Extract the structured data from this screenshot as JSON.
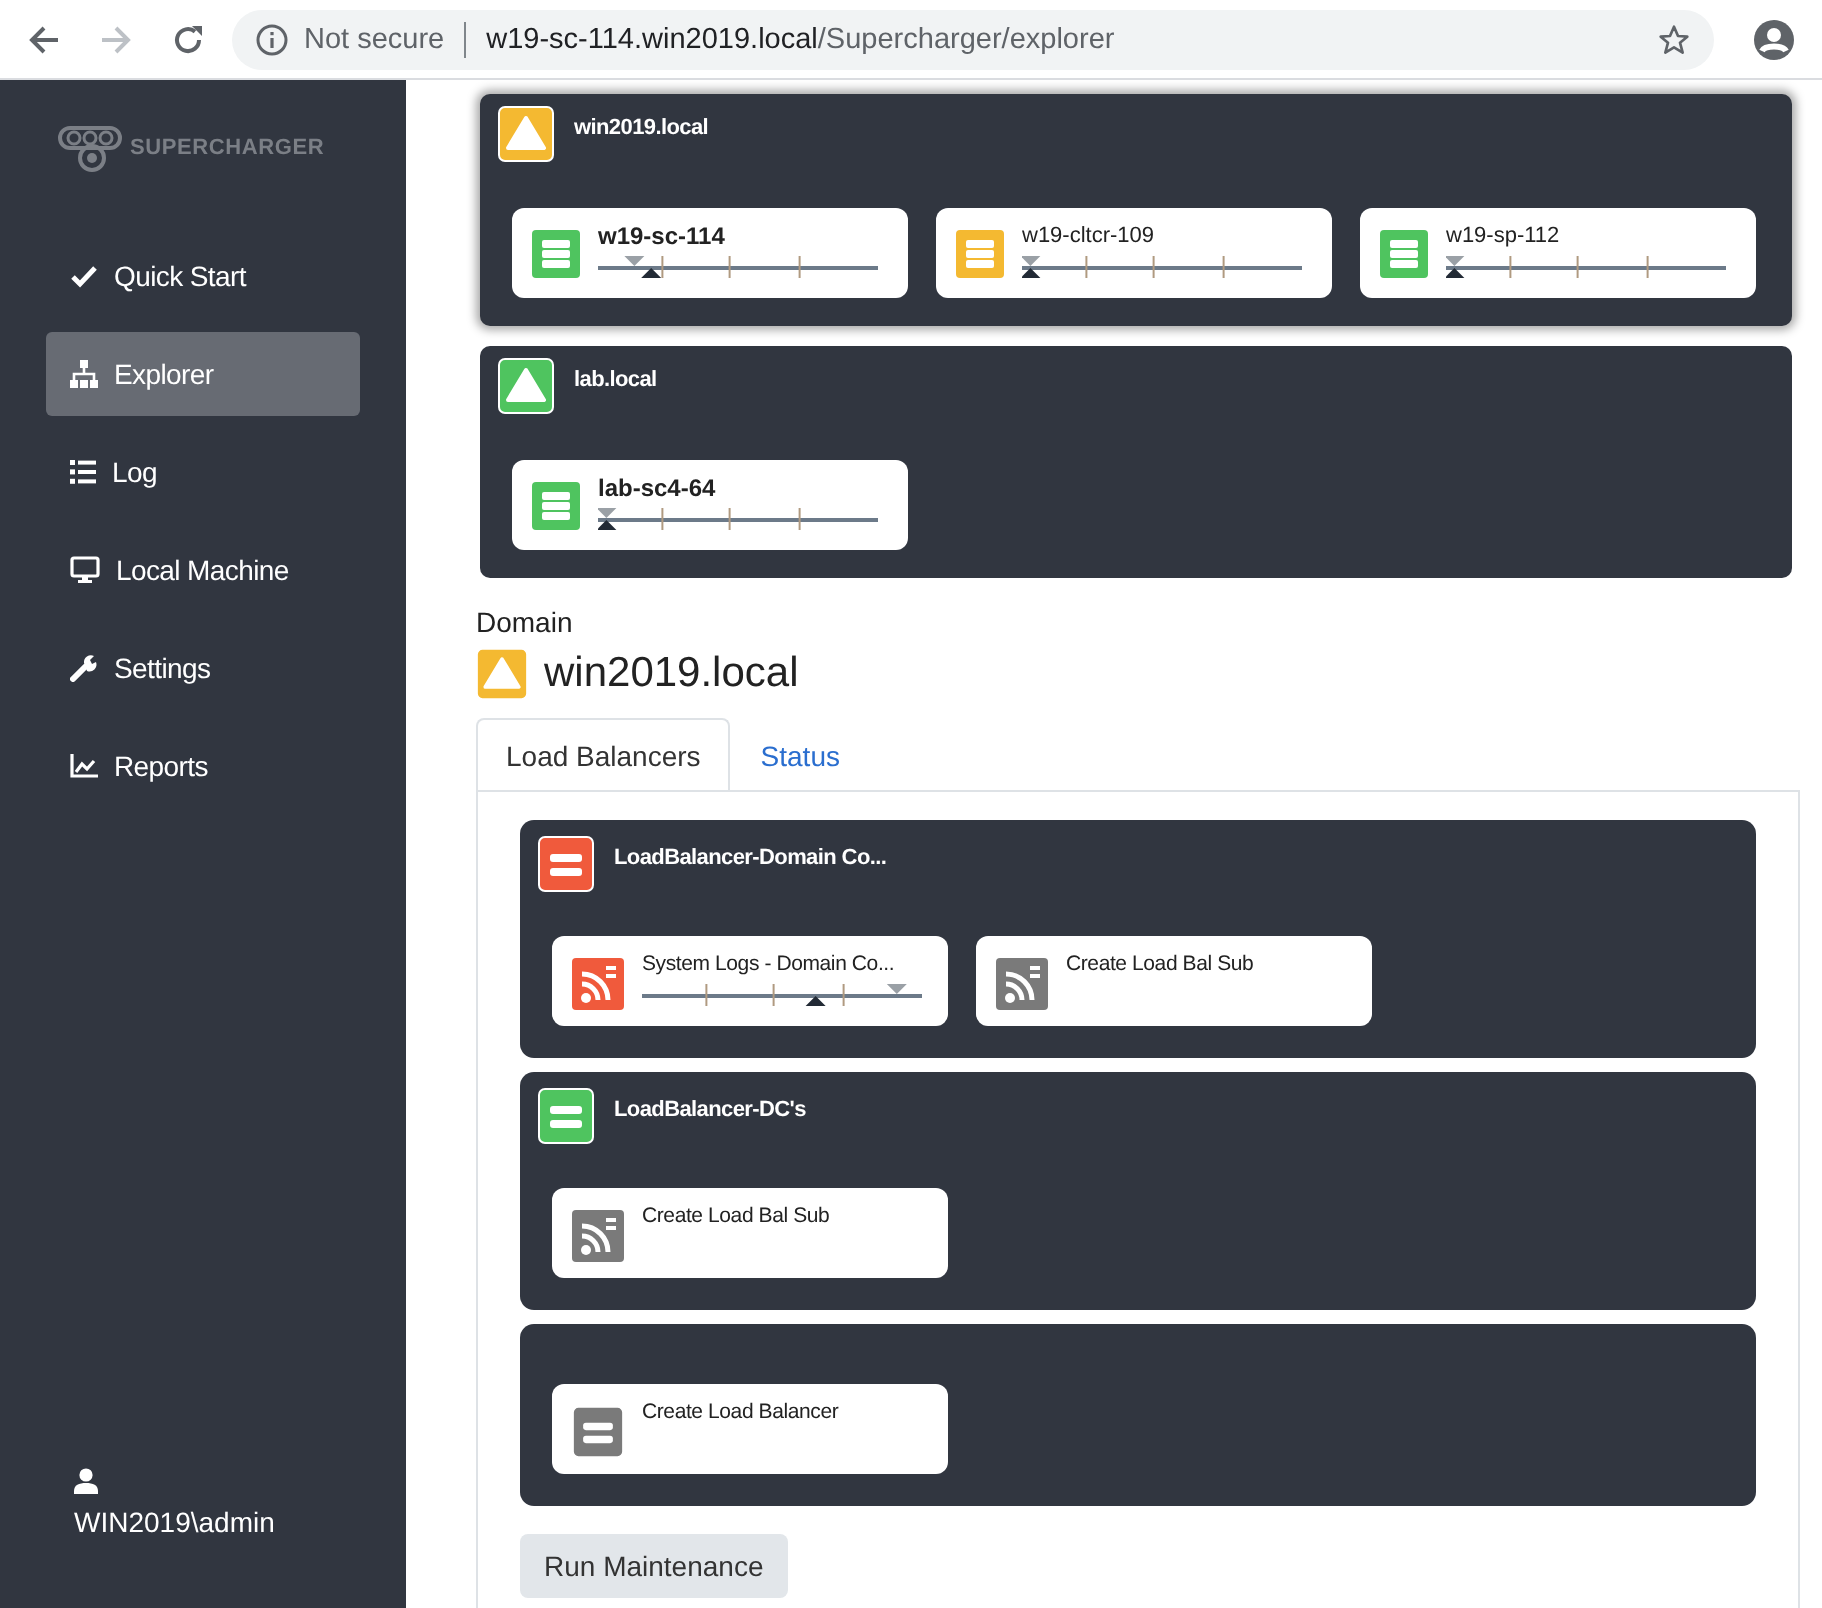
{
  "browser": {
    "security": "Not secure",
    "url_host": "w19-sc-114.win2019.local",
    "url_path": "/Supercharger/explorer"
  },
  "sidebar": {
    "logo": "SUPERCHARGER",
    "items": [
      {
        "label": "Quick Start",
        "kind": "check",
        "selected": false
      },
      {
        "label": "Explorer",
        "kind": "sitemap",
        "selected": true
      },
      {
        "label": "Log",
        "kind": "list",
        "selected": false
      },
      {
        "label": "Local Machine",
        "kind": "monitor",
        "selected": false
      },
      {
        "label": "Settings",
        "kind": "wrench",
        "selected": false
      },
      {
        "label": "Reports",
        "kind": "chart",
        "selected": false
      }
    ],
    "user": "WIN2019\\admin"
  },
  "domains": [
    {
      "name": "win2019.local",
      "color": "#f4b931",
      "selected": true,
      "servers": [
        {
          "name": "w19-sc-114",
          "color": "#4fc45f",
          "selected": true,
          "gauge": {
            "target": {
              "level": 0.13
            },
            "current": {
              "level": 0.19
            }
          }
        },
        {
          "name": "w19-cltcr-109",
          "color": "#f4b931",
          "selected": false,
          "gauge": {
            "target": {
              "level": 0.03
            },
            "current": {
              "level": 0.03
            }
          }
        },
        {
          "name": "w19-sp-112",
          "color": "#4fc45f",
          "selected": false,
          "gauge": {
            "target": {
              "level": 0.03
            },
            "current": {
              "level": 0.03
            }
          }
        }
      ]
    },
    {
      "name": "lab.local",
      "color": "#4fc45f",
      "selected": false,
      "servers": [
        {
          "name": "lab-sc4-64",
          "color": "#4fc45f",
          "selected": true,
          "gauge": {
            "target": {
              "level": 0.03
            },
            "current": {
              "level": 0.03
            }
          }
        }
      ]
    }
  ],
  "domain_detail": {
    "label": "Domain",
    "name": "win2019.local",
    "color": "#f4b931"
  },
  "tabs": [
    {
      "label": "Load Balancers",
      "selected": true
    },
    {
      "label": "Status",
      "selected": false
    }
  ],
  "load_balancers": [
    {
      "name": "LoadBalancer-Domain Co...",
      "color": "#f05a3c",
      "items": [
        {
          "name": "System Logs - Domain Co...",
          "kind": "feed",
          "color": "#f05a3c",
          "gauge": {
            "target": {
              "level": 0.91
            },
            "current": {
              "level": 0.62
            }
          }
        },
        {
          "name": "Create Load Bal Sub",
          "kind": "feed",
          "color": "#7a7a7a"
        }
      ]
    },
    {
      "name": "LoadBalancer-DC's",
      "color": "#4fc45f",
      "items": [
        {
          "name": "Create Load Bal Sub",
          "kind": "feed",
          "color": "#7a7a7a"
        }
      ]
    },
    {
      "items": [
        {
          "name": "Create Load Balancer",
          "kind": "balancer",
          "color": "#7a7a7a"
        }
      ]
    }
  ],
  "actions": [
    {
      "label": "Run Maintenance"
    }
  ]
}
